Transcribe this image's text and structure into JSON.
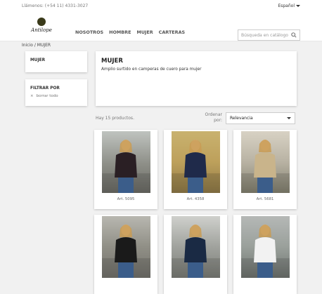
{
  "topbar": {
    "phone": "Llámenos: (+54 11) 4331-3027",
    "language": "Español"
  },
  "header": {
    "logo_text": "Antilope",
    "nav": [
      "NOSOTROS",
      "HOMBRE",
      "MUJER",
      "CARTERAS"
    ],
    "search_placeholder": "Búsqueda en catálogo"
  },
  "breadcrumb": {
    "home": "Inicio",
    "sep": "/",
    "current": "MUJER"
  },
  "sidebar": {
    "category": "MUJER",
    "filter_title": "FILTRAR POR",
    "clear_all": "borrar todo"
  },
  "category_header": {
    "title": "MUJER",
    "description": "Amplio surtido en camperas de cuero para mujer"
  },
  "listing": {
    "count_text": "Hay 15 productos.",
    "sort_label": "Ordenar por:",
    "sort_value": "Relevancia"
  },
  "products": [
    {
      "name": "Art. 5095",
      "jacket_color": "#2a1f24",
      "bg": "bg-a"
    },
    {
      "name": "Art. 4358",
      "jacket_color": "#1f2a4a",
      "bg": "bg-b"
    },
    {
      "name": "Art. 5681",
      "jacket_color": "#c9b48b",
      "bg": "bg-c"
    },
    {
      "name": "",
      "jacket_color": "#1a1a1a",
      "bg": "bg-d"
    },
    {
      "name": "",
      "jacket_color": "#1a2a44",
      "bg": "bg-e"
    },
    {
      "name": "",
      "jacket_color": "#f2f2f2",
      "bg": "bg-f"
    }
  ]
}
